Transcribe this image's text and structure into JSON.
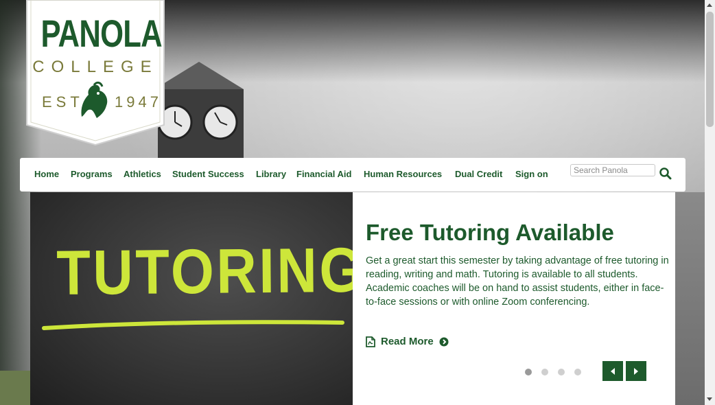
{
  "logo": {
    "name": "PANOLA",
    "subtitle": "COLLEGE",
    "est": "EST",
    "year": "1947"
  },
  "nav": {
    "items": [
      {
        "label": "Home"
      },
      {
        "label": "Programs"
      },
      {
        "label": "Athletics"
      },
      {
        "label": "Student Success"
      },
      {
        "label": "Library"
      },
      {
        "label": "Financial Aid"
      },
      {
        "label": "Human Resources"
      },
      {
        "label": "Dual Credit"
      },
      {
        "label": "Sign on"
      }
    ],
    "search": {
      "placeholder": "Search Panola",
      "value": ""
    },
    "search_icon": "search-icon"
  },
  "slide": {
    "image_text": "TUTORING",
    "title": "Free Tutoring Available",
    "body": "Get a great start this semester by taking advantage of free tutoring in reading, writing and math. Tutoring is available to all students. Academic coaches will be on hand to assist students, either in face-to-face sessions or with online Zoom conferencing.",
    "read_more": "Read More",
    "pdf_icon": "pdf-file-icon",
    "arrow_icon": "arrow-circle-right-icon",
    "dots_count": 4,
    "active_dot": 1
  },
  "colors": {
    "brand_green": "#1d5a2c",
    "chalk": "#cde63a",
    "olive": "#7a7a3a"
  }
}
